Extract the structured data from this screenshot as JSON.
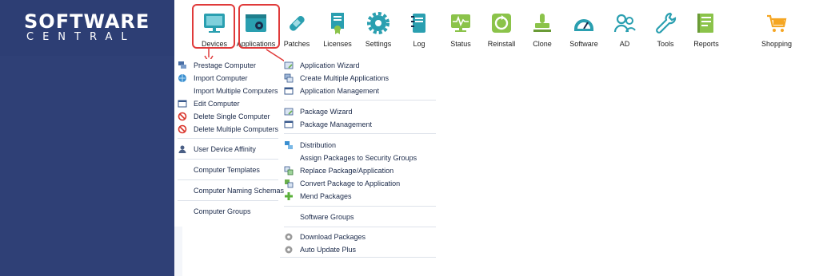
{
  "logo": {
    "main": "SOFTWARE",
    "sub": "CENTRAL"
  },
  "toolbar": {
    "items": [
      {
        "label": "Devices"
      },
      {
        "label": "Applications"
      },
      {
        "label": "Patches"
      },
      {
        "label": "Licenses"
      },
      {
        "label": "Settings"
      },
      {
        "label": "Log"
      },
      {
        "label": "Status"
      },
      {
        "label": "Reinstall"
      },
      {
        "label": "Clone"
      },
      {
        "label": "Software"
      },
      {
        "label": "AD"
      },
      {
        "label": "Tools"
      },
      {
        "label": "Reports"
      },
      {
        "label": "Shopping"
      }
    ]
  },
  "devices_menu": {
    "items": [
      {
        "label": "Prestage Computer",
        "icon": "computer-stack-icon"
      },
      {
        "label": "Import Computer",
        "icon": "globe-import-icon"
      },
      {
        "label": "Import Multiple Computers",
        "icon": ""
      },
      {
        "label": "Edit Computer",
        "icon": "window-edit-icon"
      },
      {
        "label": "Delete Single Computer",
        "icon": "no-entry-icon"
      },
      {
        "label": "Delete Multiple Computers",
        "icon": "no-entry-icon"
      },
      {
        "label": "User Device Affinity",
        "icon": "user-icon"
      },
      {
        "label": "Computer Templates",
        "icon": ""
      },
      {
        "label": "Computer Naming Schemas",
        "icon": ""
      },
      {
        "label": "Computer Groups",
        "icon": ""
      }
    ]
  },
  "applications_menu": {
    "items": [
      {
        "label": "Application Wizard",
        "icon": "wizard-icon"
      },
      {
        "label": "Create Multiple Applications",
        "icon": "multi-window-icon"
      },
      {
        "label": "Application Management",
        "icon": "window-icon"
      },
      {
        "label": "Package Wizard",
        "icon": "package-wizard-icon"
      },
      {
        "label": "Package Management",
        "icon": "window-icon"
      },
      {
        "label": "Distribution",
        "icon": "distribution-icon"
      },
      {
        "label": "Assign Packages to Security Groups",
        "icon": ""
      },
      {
        "label": "Replace Package/Application",
        "icon": "replace-icon"
      },
      {
        "label": "Convert Package to Application",
        "icon": "convert-icon"
      },
      {
        "label": "Mend Packages",
        "icon": "plus-icon"
      },
      {
        "label": "Software Groups",
        "icon": ""
      },
      {
        "label": "Download Packages",
        "icon": "gear-download-icon"
      },
      {
        "label": "Auto Update Plus",
        "icon": "gear-update-icon"
      }
    ]
  },
  "colors": {
    "sidebar": "#2f4076",
    "highlight": "#e03a3a",
    "icon_teal": "#2a9fb0",
    "icon_green": "#8bc34a",
    "icon_orange": "#f5a623"
  }
}
